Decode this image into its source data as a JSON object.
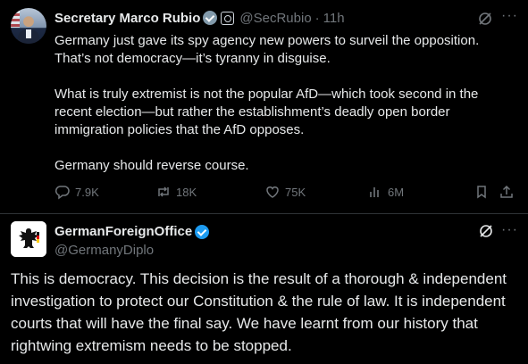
{
  "tweet1": {
    "author_name": "Secretary Marco Rubio",
    "handle": "@SecRubio",
    "separator": "·",
    "time": "11h",
    "more": "···",
    "paragraphs": [
      "Germany just gave its spy agency new powers to surveil the opposition. That’s not democracy—it’s tyranny in disguise.",
      "What is truly extremist is not the popular AfD—which took second in the recent election—but rather the establishment’s deadly open border immigration policies that the AfD opposes.",
      "Germany should reverse course."
    ],
    "stats": {
      "replies": "7.9K",
      "reposts": "18K",
      "likes": "75K",
      "views": "6M"
    }
  },
  "tweet2": {
    "author_name": "GermanForeignOffice",
    "handle": "@GermanyDiplo",
    "more": "···",
    "text": "This is democracy. This decision is the result of a thorough & independent investigation to protect our Constitution & the rule of law. It is independent courts that will have the final say. We have learnt from our history that rightwing extremism needs to be stopped."
  },
  "icons": {
    "verified_gray": "verified-badge-icon",
    "verified_blue": "verified-badge-icon",
    "government_seal": "government-seal-icon",
    "grok": "grok-icon",
    "reply": "reply-icon",
    "repost": "repost-icon",
    "like": "heart-icon",
    "views": "views-icon",
    "bookmark": "bookmark-icon",
    "share": "share-icon"
  },
  "colors": {
    "background": "#000000",
    "text": "#e7e9ea",
    "secondary": "#71767b",
    "divider": "#2f3336",
    "verified_blue": "#1d9bf0",
    "verified_gray": "#829aab"
  }
}
